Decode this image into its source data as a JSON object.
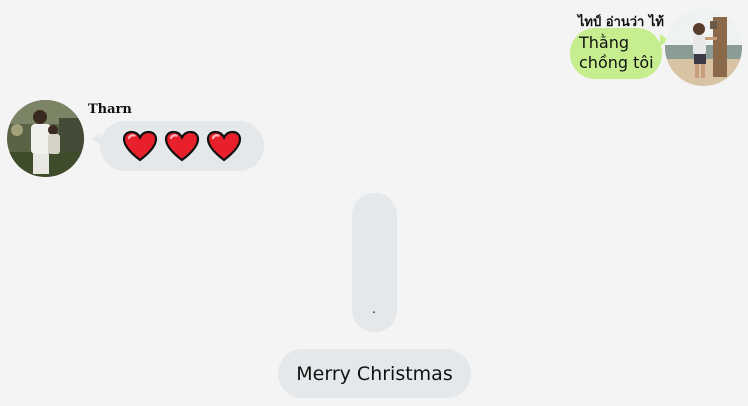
{
  "chat": {
    "messages": [
      {
        "sender": "ไทป์ อ่านว่า ไท้",
        "side": "right",
        "text_line1": "Thằng",
        "text_line2": "chồng tôi",
        "bubble_color": "#c6ee8e"
      },
      {
        "sender": "Tharn",
        "side": "left",
        "emoji": [
          "heart-icon",
          "heart-icon",
          "heart-icon"
        ],
        "bubble_color": "#e5e8ea"
      },
      {
        "side": "center",
        "text": "."
      },
      {
        "side": "center",
        "text": "Merry Christmas"
      }
    ]
  },
  "colors": {
    "background": "#f4f4f4",
    "incoming_bubble": "#e5e8ea",
    "outgoing_bubble": "#c6ee8e",
    "heart": "#e8202c"
  }
}
